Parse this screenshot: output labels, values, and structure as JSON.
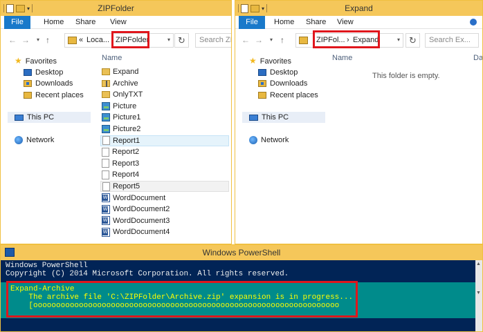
{
  "left_window": {
    "title": "ZIPFolder",
    "menu": {
      "file": "File",
      "home": "Home",
      "share": "Share",
      "view": "View"
    },
    "address": {
      "prefix": "«",
      "parent": "Loca...",
      "current": "ZIPFolder"
    },
    "search_placeholder": "Search ZI...",
    "column_name": "Name",
    "nav": {
      "favorites": "Favorites",
      "desktop": "Desktop",
      "downloads": "Downloads",
      "recent": "Recent places",
      "this_pc": "This PC",
      "network": "Network"
    },
    "files": [
      {
        "name": "Expand",
        "kind": "folder"
      },
      {
        "name": "Archive",
        "kind": "zip"
      },
      {
        "name": "OnlyTXT",
        "kind": "folder"
      },
      {
        "name": "Picture",
        "kind": "pic"
      },
      {
        "name": "Picture1",
        "kind": "pic"
      },
      {
        "name": "Picture2",
        "kind": "pic"
      },
      {
        "name": "Report1",
        "kind": "doc"
      },
      {
        "name": "Report2",
        "kind": "doc"
      },
      {
        "name": "Report3",
        "kind": "doc"
      },
      {
        "name": "Report4",
        "kind": "doc"
      },
      {
        "name": "Report5",
        "kind": "doc"
      },
      {
        "name": "WordDocument",
        "kind": "word"
      },
      {
        "name": "WordDocument2",
        "kind": "word"
      },
      {
        "name": "WordDocument3",
        "kind": "word"
      },
      {
        "name": "WordDocument4",
        "kind": "word"
      }
    ]
  },
  "right_window": {
    "title": "Expand",
    "menu": {
      "file": "File",
      "home": "Home",
      "share": "Share",
      "view": "View"
    },
    "address": {
      "parent": "ZIPFol...",
      "sep": "›",
      "current": "Expand"
    },
    "search_placeholder": "Search Ex...",
    "column_name": "Name",
    "column_date": "Da",
    "empty_text": "This folder is empty.",
    "nav": {
      "favorites": "Favorites",
      "desktop": "Desktop",
      "downloads": "Downloads",
      "recent": "Recent places",
      "this_pc": "This PC",
      "network": "Network"
    }
  },
  "powershell": {
    "title": "Windows PowerShell",
    "line1": "Windows PowerShell",
    "line2": "Copyright (C) 2014 Microsoft Corporation. All rights reserved.",
    "progress_title": "Expand-Archive",
    "progress_status": "    The archive file 'C:\\ZIPFolder\\Archive.zip' expansion is in progress...",
    "progress_bar": "    [ooooooooooooooooooooooooooooooooooooooooooooooooooooooooooooooooooo"
  },
  "colors": {
    "accent": "#1979ca",
    "highlight": "#e0161c",
    "console_bg": "#012456",
    "progress_bg": "#008b8b"
  }
}
